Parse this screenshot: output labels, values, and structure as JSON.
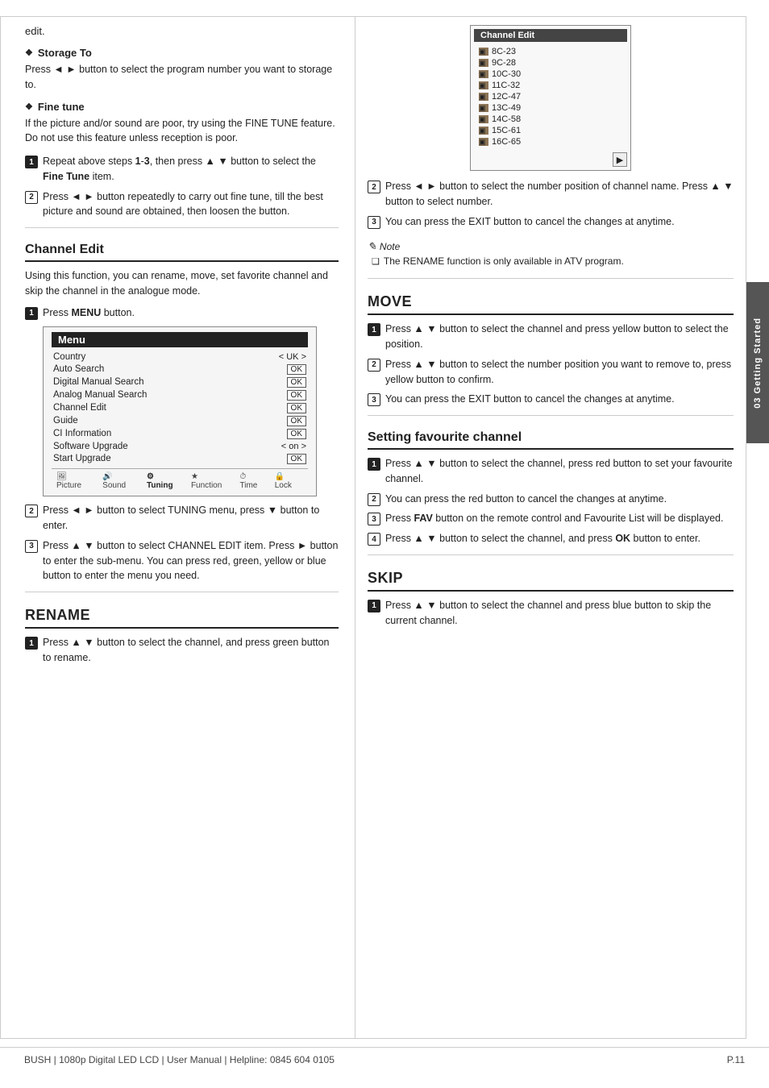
{
  "page": {
    "footer_left": "BUSH | 1080p  Digital LED LCD | User Manual | Helpline: 0845 604 0105",
    "footer_right": "P.11",
    "side_tab": "03 Getting Started"
  },
  "left": {
    "edit_text": "edit.",
    "storage_to_title": "Storage To",
    "storage_to_body": "Press ◄ ► button to select the program number you want to storage to.",
    "fine_tune_title": "Fine tune",
    "fine_tune_body": "If the picture and/or sound are poor, try using the FINE TUNE feature. Do not use this feature unless reception is poor.",
    "fine_tune_step1": "Repeat above steps 1-3, then press ▲ ▼ button to select the Fine Tune item.",
    "fine_tune_step2": "Press ◄ ► button repeatedly to carry out fine tune, till the best picture and sound are obtained, then loosen the button.",
    "channel_edit_heading": "Channel Edit",
    "channel_edit_intro": "Using this function, you can rename, move, set favorite channel and skip the channel in the analogue mode.",
    "channel_edit_step1": "Press MENU button.",
    "menu_title": "Menu",
    "menu_rows": [
      {
        "label": "Country",
        "value": "< UK >"
      },
      {
        "label": "Auto Search",
        "value": "OK"
      },
      {
        "label": "Digital Manual Search",
        "value": "OK"
      },
      {
        "label": "Analog Manual Search",
        "value": "OK"
      },
      {
        "label": "Channel Edit",
        "value": "OK"
      },
      {
        "label": "Guide",
        "value": "OK"
      },
      {
        "label": "CI Information",
        "value": "OK"
      },
      {
        "label": "Software Upgrade",
        "value": "< on >"
      },
      {
        "label": "Start Upgrade",
        "value": "OK"
      }
    ],
    "menu_tabs": [
      "Picture",
      "Sound",
      "Tuning",
      "Function",
      "Time",
      "Lock"
    ],
    "channel_edit_step2": "Press ◄ ► button to select TUNING menu, press ▼ button to enter.",
    "channel_edit_step3": "Press ▲ ▼ button to select CHANNEL EDIT item. Press ► button to enter the sub-menu. You can press red, green, yellow or blue button to enter the menu you need.",
    "rename_heading": "RENAME",
    "rename_step1": "Press ▲ ▼ button to select the channel, and press green button to rename."
  },
  "right": {
    "channel_panel_title": "Channel Edit",
    "channel_list": [
      "8C-23",
      "9C-28",
      "10C-30",
      "11C-32",
      "12C-47",
      "13C-49",
      "14C-58",
      "15C-61",
      "16C-65"
    ],
    "right_rename_step2": "Press ◄ ► button to select the number position of channel name. Press ▲ ▼ button to select number.",
    "right_rename_step3": "You can press the EXIT button to cancel the changes at anytime.",
    "note_title": "Note",
    "note_item": "The RENAME function is only available in ATV program.",
    "move_heading": "MOVE",
    "move_step1": "Press ▲ ▼ button to select the channel and press yellow button to select the position.",
    "move_step2": "Press ▲ ▼ button to select the number position you want to remove to, press yellow button to confirm.",
    "move_step3": "You can press the EXIT button to cancel the changes at anytime.",
    "fav_heading": "Setting favourite channel",
    "fav_step1": "Press ▲ ▼ button to select the channel, press red button to set your favourite channel.",
    "fav_step2": "You can press the red button to cancel the changes at anytime.",
    "fav_step3": "Press FAV button on the remote control and Favourite List will be displayed.",
    "fav_step4": "Press ▲ ▼ button to select the channel, and press OK button to enter.",
    "skip_heading": "SKIP",
    "skip_step1": "Press ▲ ▼ button to select the channel and press blue button to skip the current channel."
  }
}
